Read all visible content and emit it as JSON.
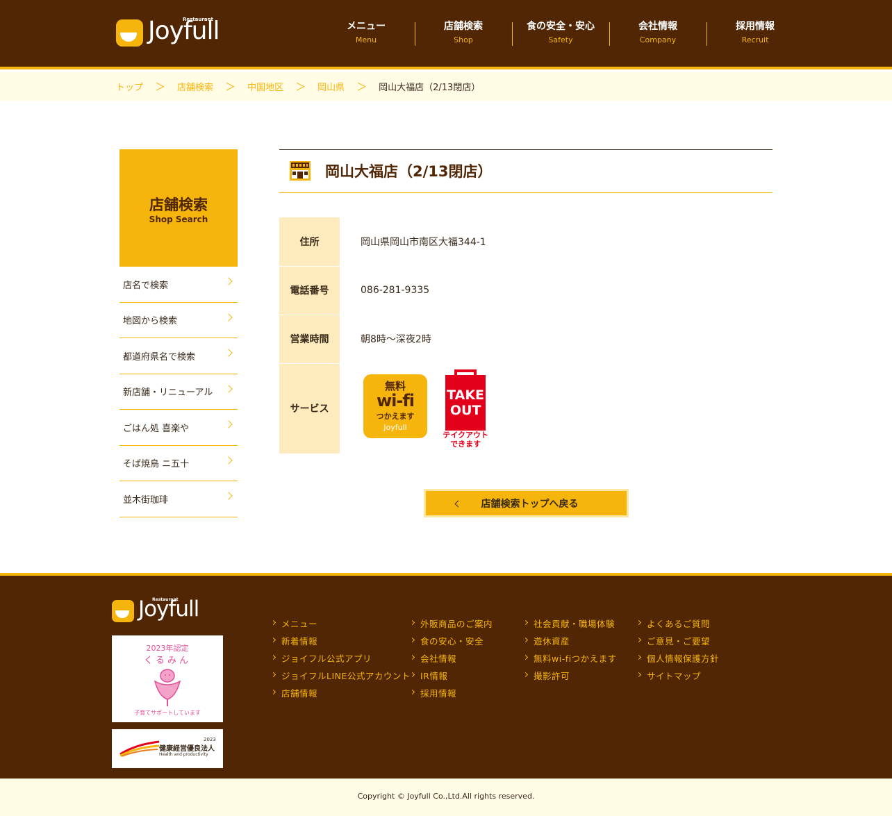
{
  "header": {
    "logo_word": "Joyfull",
    "logo_tag": "Restaurant",
    "nav": [
      {
        "ja": "メニュー",
        "en": "Menu"
      },
      {
        "ja": "店舗検索",
        "en": "Shop"
      },
      {
        "ja": "食の安全・安心",
        "en": "Safety"
      },
      {
        "ja": "会社情報",
        "en": "Company"
      },
      {
        "ja": "採用情報",
        "en": "Recruit"
      }
    ]
  },
  "breadcrumb": {
    "items": [
      "トップ",
      "店舗検索",
      "中国地区",
      "岡山県"
    ],
    "separator": "＞",
    "current": "岡山大福店（2/13閉店）"
  },
  "sidebar": {
    "title_ja": "店舗検索",
    "title_en": "Shop Search",
    "items": [
      "店名で検索",
      "地図から検索",
      "都道府県名で検索",
      "新店舗・リニューアル",
      "ごはん処 喜楽や",
      "そば焼鳥 ニ五十",
      "並木街珈琲"
    ]
  },
  "shop": {
    "name": "岡山大福店（2/13閉店）",
    "address_label": "住所",
    "address": "岡山県岡山市南区大福344-1",
    "phone_label": "電話番号",
    "phone": "086-281-9335",
    "hours_label": "営業時間",
    "hours": "朝8時〜深夜2時",
    "service_label": "サービス",
    "wifi_badge": {
      "line1": "無料",
      "line2": "wi-fi",
      "line3": "つかえます",
      "line4": "Joyfull"
    },
    "takeout_badge": {
      "line1": "TAKE",
      "line2": "OUT",
      "sub1": "テイクアウト",
      "sub2": "できます"
    },
    "back_button": "店舗検索トップへ戻る"
  },
  "footer": {
    "logo_word": "Joyfull",
    "logo_tag": "Restaurant",
    "kurumin": {
      "year": "2023年認定",
      "name": "くるみん",
      "foot": "子育てサポートしています"
    },
    "kenko": {
      "text": "健康経営優良法人",
      "year": "2023",
      "en": "Health and productivity"
    },
    "col1": [
      "メニュー",
      "新着情報",
      "ジョイフル公式アプリ",
      "ジョイフルLINE公式アカウント",
      "店舗情報"
    ],
    "col2": [
      "外販商品のご案内",
      "食の安心・安全",
      "会社情報",
      "IR情報",
      "採用情報"
    ],
    "col3": [
      "社会貢献・職場体験",
      "遊休資産",
      "無料wi-fiつかえます",
      "撮影許可"
    ],
    "col4": [
      "よくあるご質問",
      "ご意見・ご要望",
      "個人情報保護方針",
      "サイトマップ"
    ],
    "copyright": "Copyright © Joyfull Co.,Ltd.All rights reserved."
  },
  "colors": {
    "brown": "#502605",
    "accent": "#f6b50c",
    "cream": "#fffbe4",
    "label_bg": "#fdebbe",
    "takeout_red": "#e2001a"
  }
}
